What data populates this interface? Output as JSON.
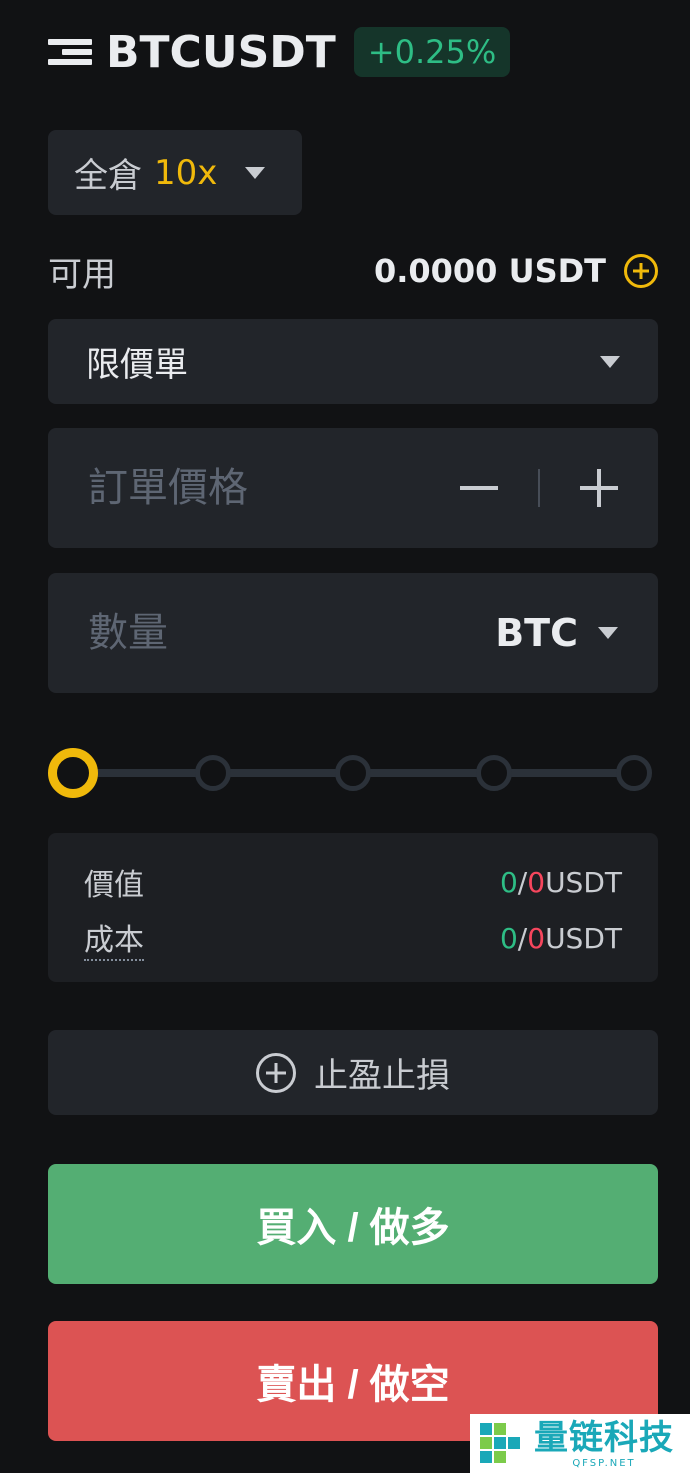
{
  "header": {
    "symbol": "BTCUSDT",
    "change": "+0.25%"
  },
  "margin": {
    "mode": "全倉",
    "leverage": "10x"
  },
  "available": {
    "label": "可用",
    "value": "0.0000 USDT"
  },
  "order_type": {
    "selected": "限價單"
  },
  "price_field": {
    "placeholder": "訂單價格"
  },
  "quantity_field": {
    "placeholder": "數量",
    "unit": "BTC"
  },
  "slider": {
    "value_fraction": 0,
    "stops": 5
  },
  "summary": {
    "rows": [
      {
        "label": "價值",
        "buy": "0",
        "sep": "/",
        "sell": "0",
        "unit": "USDT"
      },
      {
        "label": "成本",
        "buy": "0",
        "sep": "/",
        "sell": "0",
        "unit": "USDT"
      }
    ]
  },
  "tpsl": {
    "label": "止盈止損"
  },
  "actions": {
    "buy_label": "買入 / 做多",
    "sell_label": "賣出 / 做空"
  },
  "watermark": {
    "text": "量链科技",
    "sub": "QFSP.NET"
  },
  "colors": {
    "accent": "#f0b90b",
    "buy": "#54ae73",
    "sell": "#dc5353",
    "up": "#2ebd85",
    "down": "#f6465d"
  },
  "icons": [
    "menu-icon",
    "caret-down-icon",
    "plus-circle-icon",
    "minus-icon",
    "plus-icon"
  ]
}
